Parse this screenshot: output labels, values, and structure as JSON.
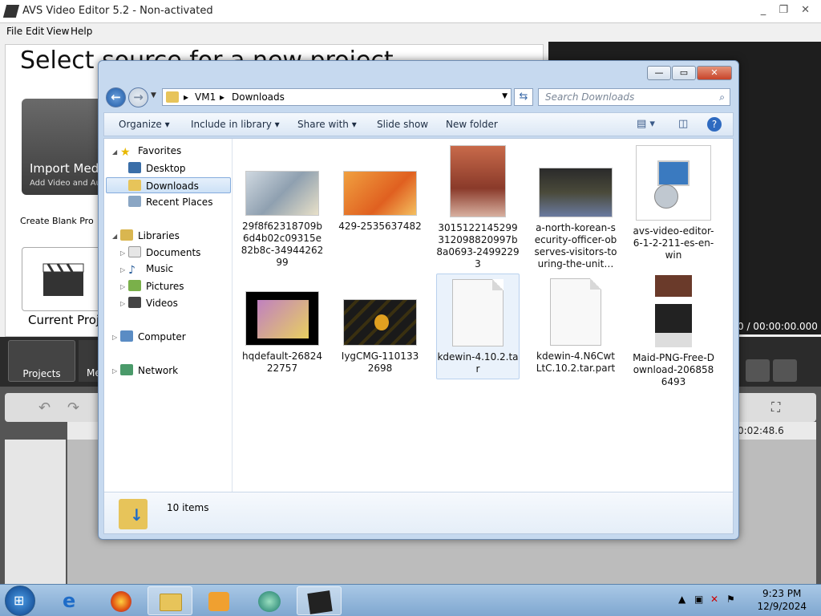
{
  "avs": {
    "title": "AVS Video Editor 5.2 - Non-activated",
    "menu": [
      "File",
      "Edit",
      "View",
      "Help"
    ],
    "heading": "Select source for a new project",
    "import_title": "Import Medi",
    "import_sub": "Add Video and Au",
    "create_blank": "Create Blank Pro",
    "current_project": "Current Proj",
    "time_display": "0 / 00:00:00.000",
    "projects_tab": "Projects",
    "media_tab": "Me",
    "timeline_time": "0:02:48.6"
  },
  "explorer": {
    "address": {
      "segments": [
        "VM1",
        "Downloads"
      ]
    },
    "search_placeholder": "Search Downloads",
    "commands": [
      "Organize",
      "Include in library",
      "Share with",
      "Slide show",
      "New folder"
    ],
    "nav": {
      "favorites": "Favorites",
      "desktop": "Desktop",
      "downloads": "Downloads",
      "recent": "Recent Places",
      "libraries": "Libraries",
      "documents": "Documents",
      "music": "Music",
      "pictures": "Pictures",
      "videos": "Videos",
      "computer": "Computer",
      "network": "Network"
    },
    "files": [
      {
        "name": "29f8f62318709b6d4b02c09315e82b8c-3494426299"
      },
      {
        "name": "429-2535637482"
      },
      {
        "name": "3015122145299312098820997b8a0693-24992293"
      },
      {
        "name": "a-north-korean-security-officer-observes-visitors-touring-the-unit…"
      },
      {
        "name": "avs-video-editor-6-1-2-211-es-en-win"
      },
      {
        "name": "hqdefault-2682422757"
      },
      {
        "name": "IygCMG-1101332698"
      },
      {
        "name": "kdewin-4.10.2.tar"
      },
      {
        "name": "kdewin-4.N6CwtLtC.10.2.tar.part"
      },
      {
        "name": "Maid-PNG-Free-Download-2068586493"
      }
    ],
    "item_count": "10 items"
  },
  "taskbar": {
    "time": "9:23 PM",
    "date": "12/9/2024"
  }
}
